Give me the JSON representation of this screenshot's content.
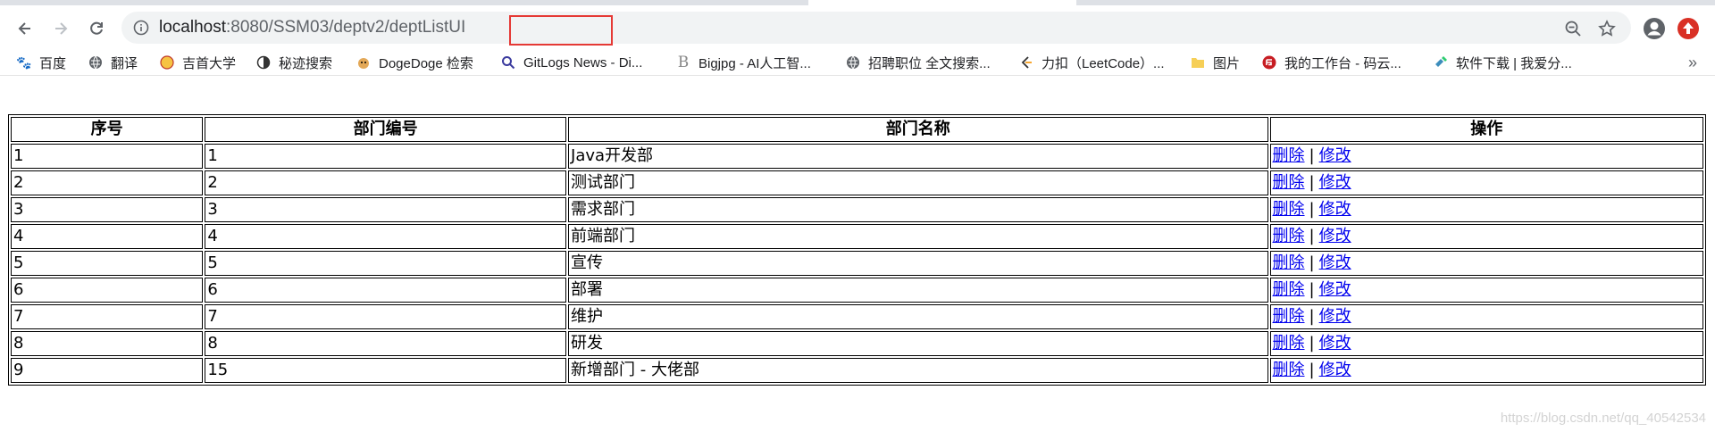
{
  "browser": {
    "url_host": "localhost",
    "url_rest": ":8080/SSM03/deptv2/",
    "url_path_highlight": "deptListUI"
  },
  "bookmarks": [
    {
      "label": "百度",
      "icon": "baidu-paw-icon"
    },
    {
      "label": "翻译",
      "icon": "globe-icon"
    },
    {
      "label": "吉首大学",
      "icon": "university-logo-icon"
    },
    {
      "label": "秘迹搜索",
      "icon": "mijisou-icon"
    },
    {
      "label": "DogeDoge 检索",
      "icon": "doge-icon"
    },
    {
      "label": "GitLogs News - Di...",
      "icon": "search-icon"
    },
    {
      "label": "Bigjpg - AI人工智...",
      "icon": "bigjpg-b-icon"
    },
    {
      "label": "招聘职位 全文搜索...",
      "icon": "globe-icon"
    },
    {
      "label": "力扣（LeetCode）...",
      "icon": "leetcode-icon"
    },
    {
      "label": "图片",
      "icon": "folder-icon"
    },
    {
      "label": "我的工作台 - 码云...",
      "icon": "gitee-icon"
    },
    {
      "label": "软件下载 | 我爱分...",
      "icon": "software-icon"
    }
  ],
  "bookmarks_more": "»",
  "table": {
    "headers": [
      "序号",
      "部门编号",
      "部门名称",
      "操作"
    ],
    "delete_label": "删除",
    "separator": "|",
    "edit_label": "修改",
    "rows": [
      {
        "index": "1",
        "dept_id": "1",
        "dept_name": "Java开发部"
      },
      {
        "index": "2",
        "dept_id": "2",
        "dept_name": "测试部门"
      },
      {
        "index": "3",
        "dept_id": "3",
        "dept_name": "需求部门"
      },
      {
        "index": "4",
        "dept_id": "4",
        "dept_name": "前端部门"
      },
      {
        "index": "5",
        "dept_id": "5",
        "dept_name": "宣传"
      },
      {
        "index": "6",
        "dept_id": "6",
        "dept_name": "部署"
      },
      {
        "index": "7",
        "dept_id": "7",
        "dept_name": "维护"
      },
      {
        "index": "8",
        "dept_id": "8",
        "dept_name": "研发"
      },
      {
        "index": "9",
        "dept_id": "15",
        "dept_name": "新增部门 - 大佬部"
      }
    ]
  },
  "watermark": "https://blog.csdn.net/qq_40542534",
  "colors": {
    "accent_red": "#e53935",
    "link": "#0000ee",
    "omnibox_bg": "#f1f3f4"
  }
}
